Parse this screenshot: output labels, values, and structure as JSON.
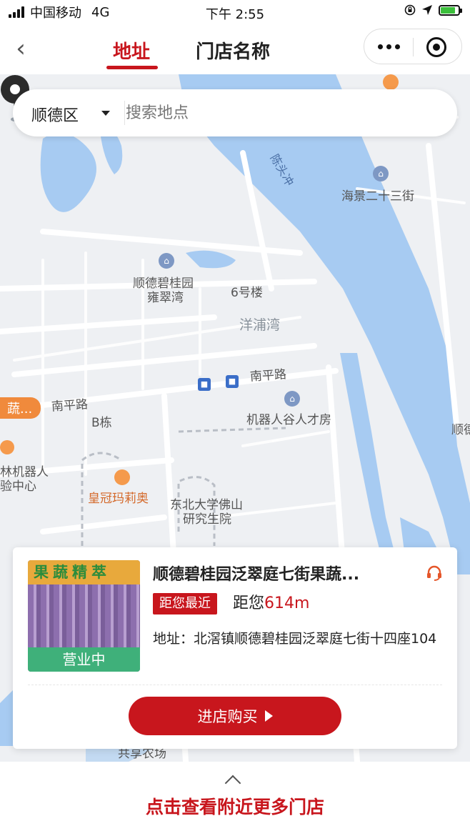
{
  "status_bar": {
    "carrier": "中国移动",
    "network": "4G",
    "time": "下午 2:55",
    "battery_level": 0.85
  },
  "nav": {
    "tabs": [
      {
        "label": "地址",
        "active": true
      },
      {
        "label": "门店名称",
        "active": false
      }
    ]
  },
  "search": {
    "district": "顺德区",
    "placeholder": "搜索地点"
  },
  "map": {
    "labels": {
      "chentouyong": "陈头冲",
      "haijing": "海景二十三街",
      "bgy_line1": "顺德碧桂园",
      "bgy_line2": "雍翠湾",
      "building6": "6号楼",
      "yangpuwan": "洋浦湾",
      "nanping1": "南平路",
      "nanping2": "南平路",
      "b_building": "B栋",
      "talent_house": "机器人谷人才房",
      "robot_center_line1": "林机器人",
      "robot_center_line2": "验中心",
      "huangguan": "皇冠玛莉奥",
      "neu_line1": "东北大学佛山",
      "neu_line2": "研究生院",
      "right_edge": "顺德",
      "gongxiang": "共享农场",
      "veg_badge": "蔬..."
    },
    "colors": {
      "water": "#a7cbf2",
      "road": "#ffffff",
      "land": "#eef0f3"
    }
  },
  "store": {
    "sign_text": "果蔬精萃",
    "status": "营业中",
    "name": "顺德碧桂园泛翠庭七街果蔬...",
    "nearest_label": "距您最近",
    "distance_prefix": "距您",
    "distance_value": "614m",
    "address": "地址：北滘镇顺德碧桂园泛翠庭七街十四座104",
    "buy_label": "进店购买"
  },
  "footer": {
    "more_label": "点击查看附近更多门店"
  },
  "colors": {
    "accent": "#c8161d",
    "open_green": "#3fb07a",
    "poi_orange": "#f08a3c"
  }
}
